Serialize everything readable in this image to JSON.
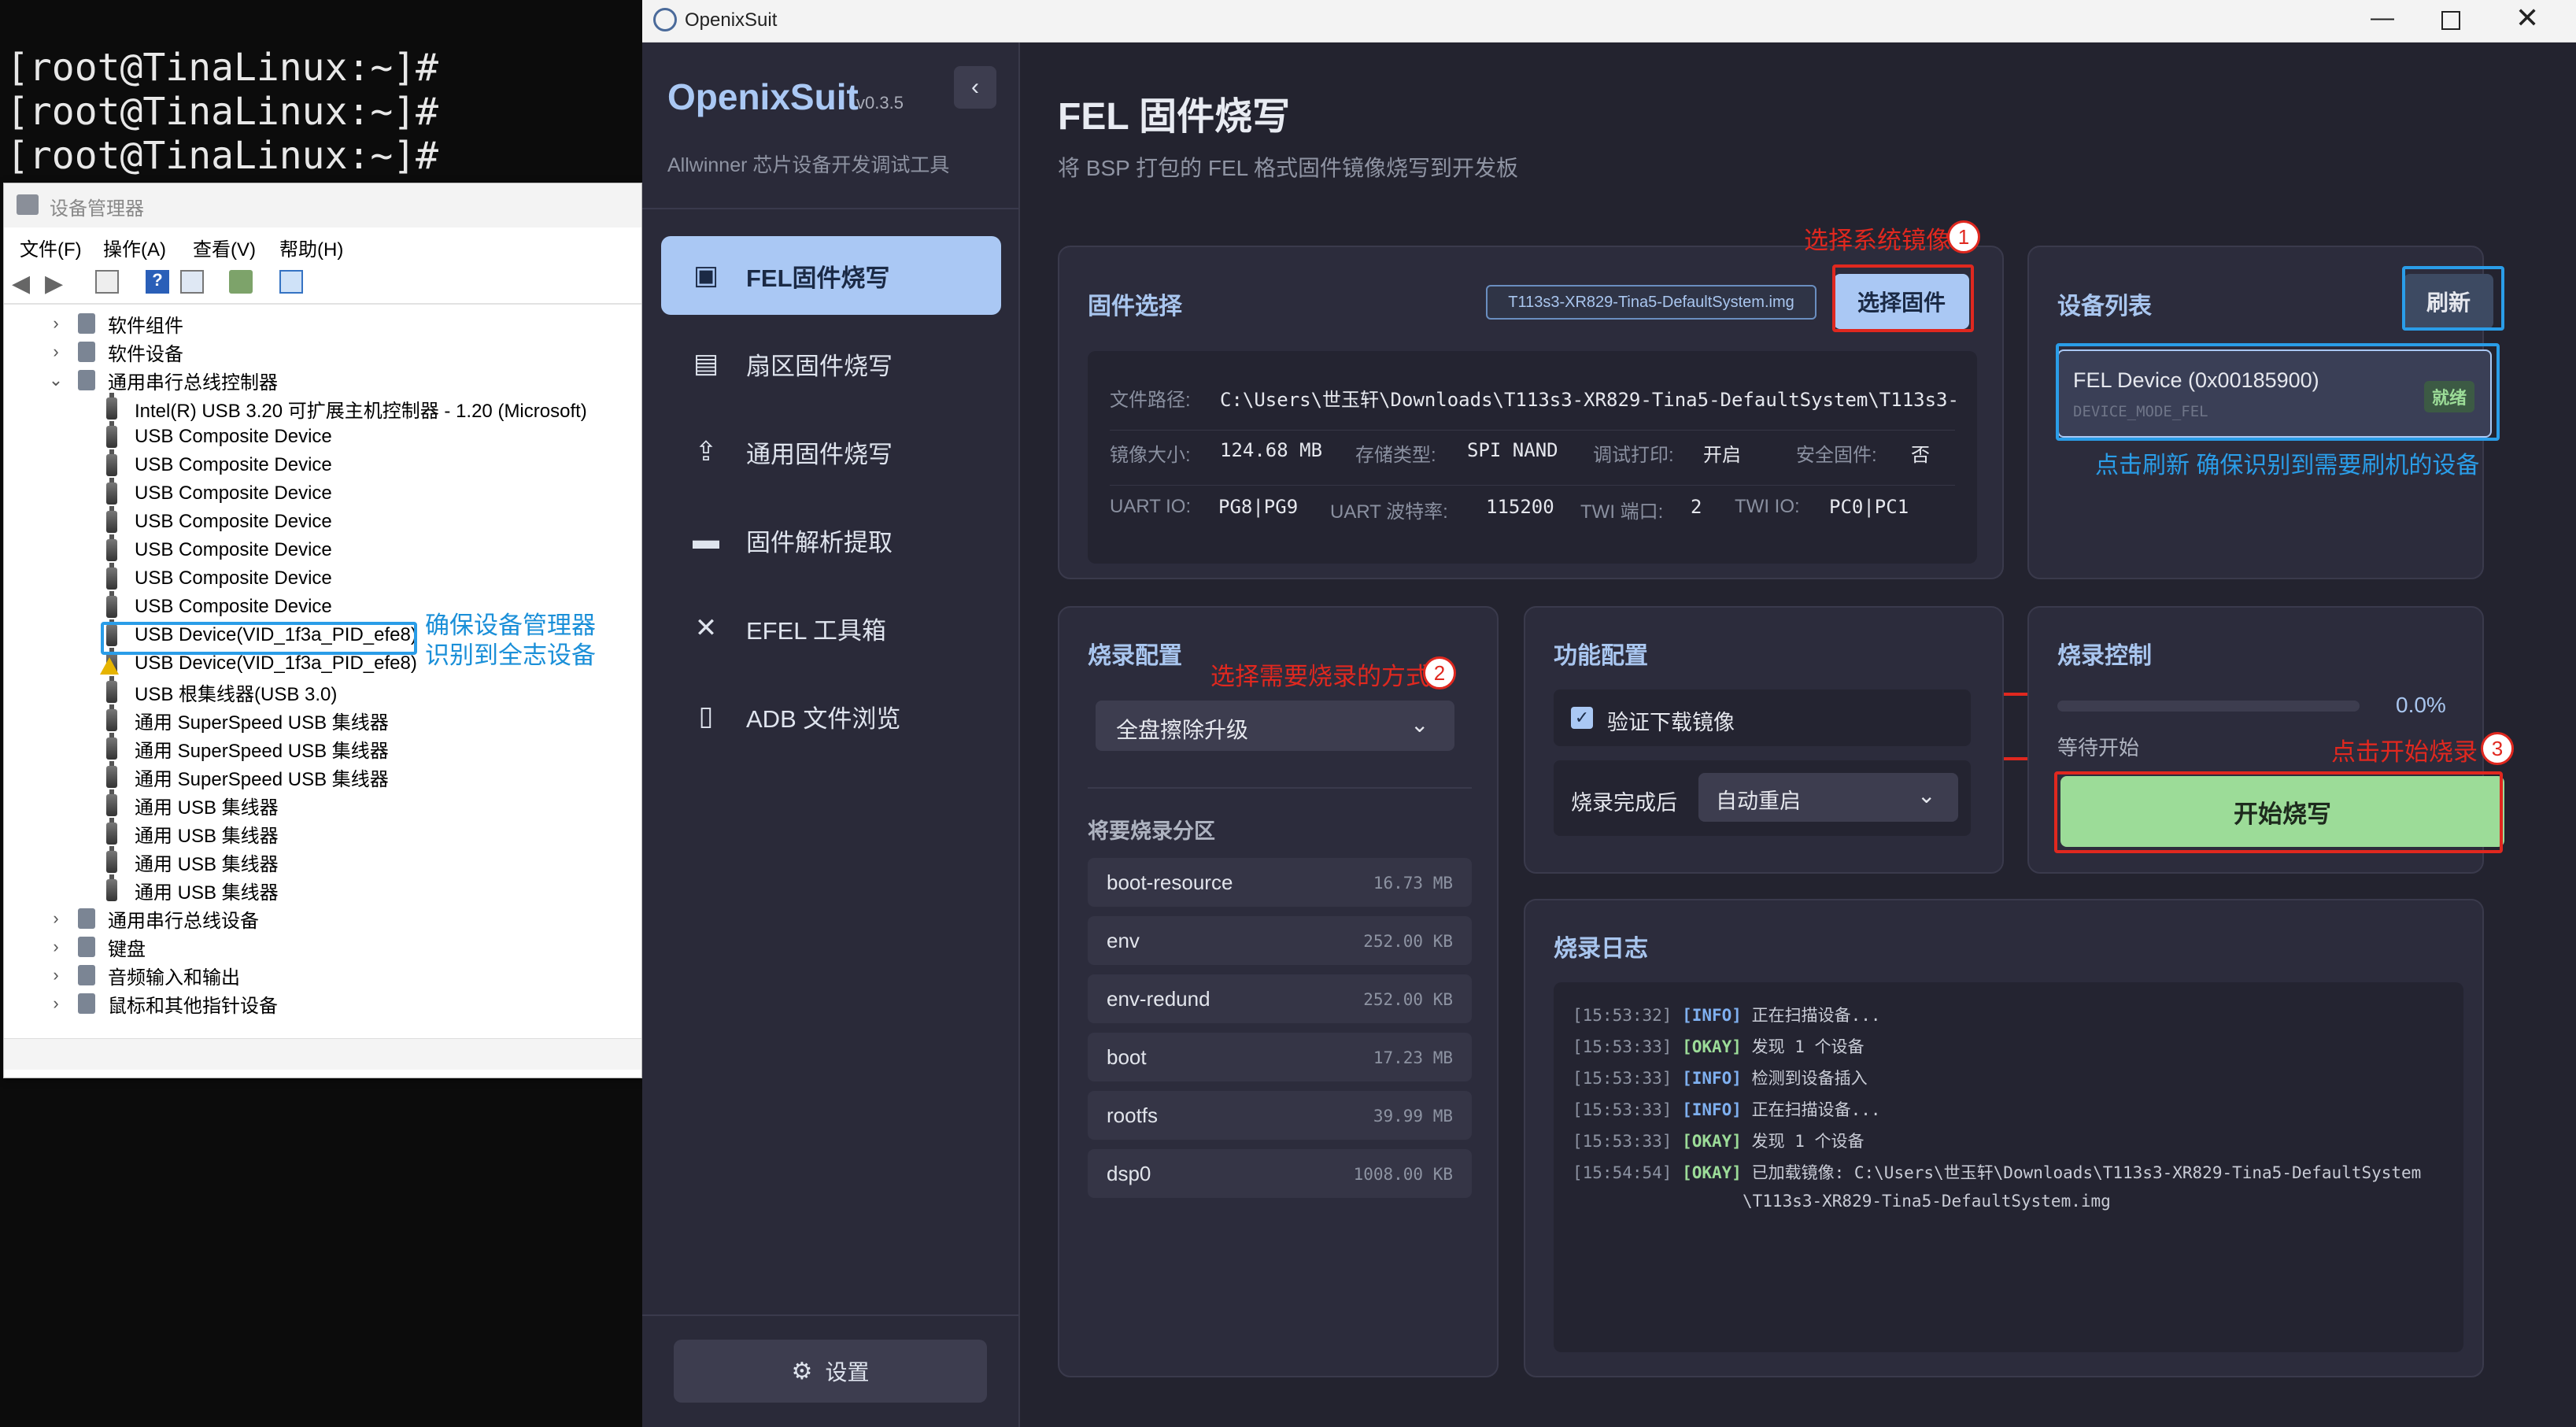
{
  "terminal": {
    "lines": [
      "[root@TinaLinux:~]#",
      "[root@TinaLinux:~]#",
      "[root@TinaLinux:~]#"
    ]
  },
  "device_manager": {
    "title": "设备管理器",
    "menu": [
      "文件(F)",
      "操作(A)",
      "查看(V)",
      "帮助(H)"
    ],
    "tree": [
      {
        "label": "软件组件",
        "level": 0,
        "expanded": false
      },
      {
        "label": "软件设备",
        "level": 0,
        "expanded": false
      },
      {
        "label": "通用串行总线控制器",
        "level": 0,
        "expanded": true
      },
      {
        "label": "Intel(R) USB 3.20 可扩展主机控制器 - 1.20 (Microsoft)",
        "level": 1
      },
      {
        "label": "USB Composite Device",
        "level": 1
      },
      {
        "label": "USB Composite Device",
        "level": 1
      },
      {
        "label": "USB Composite Device",
        "level": 1
      },
      {
        "label": "USB Composite Device",
        "level": 1
      },
      {
        "label": "USB Composite Device",
        "level": 1
      },
      {
        "label": "USB Composite Device",
        "level": 1
      },
      {
        "label": "USB Composite Device",
        "level": 1
      },
      {
        "label": "USB Device(VID_1f3a_PID_efe8)",
        "level": 1,
        "highlight": true
      },
      {
        "label": "USB Device(VID_1f3a_PID_efe8)",
        "level": 1,
        "warning": true
      },
      {
        "label": "USB 根集线器(USB 3.0)",
        "level": 1
      },
      {
        "label": "通用 SuperSpeed USB 集线器",
        "level": 1
      },
      {
        "label": "通用 SuperSpeed USB 集线器",
        "level": 1
      },
      {
        "label": "通用 SuperSpeed USB 集线器",
        "level": 1
      },
      {
        "label": "通用 USB 集线器",
        "level": 1
      },
      {
        "label": "通用 USB 集线器",
        "level": 1
      },
      {
        "label": "通用 USB 集线器",
        "level": 1
      },
      {
        "label": "通用 USB 集线器",
        "level": 1
      },
      {
        "label": "通用串行总线设备",
        "level": 0,
        "expanded": false
      },
      {
        "label": "键盘",
        "level": 0,
        "expanded": false
      },
      {
        "label": "音频输入和输出",
        "level": 0,
        "expanded": false
      },
      {
        "label": "鼠标和其他指针设备",
        "level": 0,
        "expanded": false
      }
    ],
    "annotation_line1": "确保设备管理器",
    "annotation_line2": "识别到全志设备"
  },
  "app": {
    "window_title": "OpenixSuit",
    "name": "OpenixSuit",
    "version": "v0.3.5",
    "subtitle": "Allwinner 芯片设备开发调试工具",
    "nav": [
      {
        "label": "FEL固件烧写",
        "icon": "chip-icon",
        "active": true
      },
      {
        "label": "扇区固件烧写",
        "icon": "sd-card-icon"
      },
      {
        "label": "通用固件烧写",
        "icon": "upload-icon"
      },
      {
        "label": "固件解析提取",
        "icon": "folder-icon"
      },
      {
        "label": "EFEL 工具箱",
        "icon": "tools-icon"
      },
      {
        "label": "ADB 文件浏览",
        "icon": "file-icon"
      }
    ],
    "settings_label": "设置",
    "page_title": "FEL 固件烧写",
    "page_subtitle": "将 BSP 打包的 FEL 格式固件镜像烧写到开发板",
    "firmware": {
      "title": "固件选择",
      "file_chip": "T113s3-XR829-Tina5-DefaultSystem.img",
      "select_button": "选择固件",
      "path_label": "文件路径:",
      "path_value": "C:\\Users\\世玉轩\\Downloads\\T113s3-XR829-Tina5-DefaultSystem\\T113s3-",
      "size_label": "镜像大小:",
      "size_value": "124.68 MB",
      "storage_label": "存储类型:",
      "storage_value": "SPI NAND",
      "debug_label": "调试打印:",
      "debug_value": "开启",
      "secure_label": "安全固件:",
      "secure_value": "否",
      "uart_io_label": "UART IO:",
      "uart_io_value": "PG8|PG9",
      "baud_label": "UART 波特率:",
      "baud_value": "115200",
      "twi_port_label": "TWI 端口:",
      "twi_port_value": "2",
      "twi_io_label": "TWI IO:",
      "twi_io_value": "PC0|PC1"
    },
    "devices": {
      "title": "设备列表",
      "refresh_button": "刷新",
      "device_name": "FEL Device (0x00185900)",
      "device_mode": "DEVICE_MODE_FEL",
      "device_status": "就绪"
    },
    "flash_config": {
      "title": "烧录配置",
      "mode_value": "全盘擦除升级",
      "partitions_title": "将要烧录分区",
      "partitions": [
        {
          "name": "boot-resource",
          "size": "16.73 MB"
        },
        {
          "name": "env",
          "size": "252.00 KB"
        },
        {
          "name": "env-redund",
          "size": "252.00 KB"
        },
        {
          "name": "boot",
          "size": "17.23 MB"
        },
        {
          "name": "rootfs",
          "size": "39.99 MB"
        },
        {
          "name": "dsp0",
          "size": "1008.00 KB"
        }
      ]
    },
    "function_config": {
      "title": "功能配置",
      "verify_label": "验证下载镜像",
      "verify_checked": true,
      "after_label": "烧录完成后",
      "after_value": "自动重启"
    },
    "control": {
      "title": "烧录控制",
      "progress_percent": 0,
      "progress_text": "0.0%",
      "status": "等待开始",
      "start_button": "开始烧写"
    },
    "log": {
      "title": "烧录日志",
      "lines": [
        {
          "time": "[15:53:32]",
          "tag": "[INFO]",
          "msg": "正在扫描设备..."
        },
        {
          "time": "[15:53:33]",
          "tag": "[OKAY]",
          "msg": "发现 1 个设备"
        },
        {
          "time": "[15:53:33]",
          "tag": "[INFO]",
          "msg": "检测到设备插入"
        },
        {
          "time": "[15:53:33]",
          "tag": "[INFO]",
          "msg": "正在扫描设备..."
        },
        {
          "time": "[15:53:33]",
          "tag": "[OKAY]",
          "msg": "发现 1 个设备"
        },
        {
          "time": "[15:54:54]",
          "tag": "[OKAY]",
          "msg": "已加载镜像: C:\\Users\\世玉轩\\Downloads\\T113s3-XR829-Tina5-DefaultSystem"
        },
        {
          "time": "",
          "tag": "",
          "msg": "\\T113s3-XR829-Tina5-DefaultSystem.img"
        }
      ]
    },
    "annotations": {
      "a1": "选择系统镜像",
      "a2": "选择需要烧录的方式",
      "a3": "点击开始烧录",
      "refresh_note": "点击刷新 确保识别到需要刷机的设备",
      "n1": "1",
      "n2": "2",
      "n3": "3"
    },
    "colors": {
      "accent": "#aac8f4",
      "title_blue": "#a9c6ef",
      "start_green": "#9cdc98",
      "info": "#7fb0f0",
      "okay": "#9cdc98",
      "annotation_red": "#e0281f",
      "annotation_blue": "#2a9de8"
    }
  }
}
